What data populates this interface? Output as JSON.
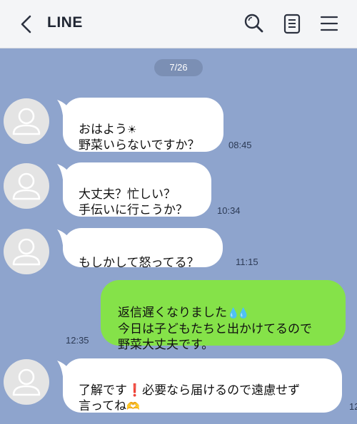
{
  "header": {
    "title": "LINE",
    "icons": [
      "back-icon",
      "search-icon",
      "memo-icon",
      "menu-icon"
    ]
  },
  "date_chip": "7/26",
  "messages": [
    {
      "side": "in",
      "lines": [
        "おはよう",
        "野菜いらないですか？"
      ],
      "emoji": "sun",
      "time": "08:45"
    },
    {
      "side": "in",
      "lines": [
        "大丈夫？忙しい？",
        "手伝いに行こうか？"
      ],
      "time": "10:34"
    },
    {
      "side": "in",
      "lines": [
        "もしかして怒ってる？"
      ],
      "time": "11:15"
    },
    {
      "side": "out",
      "lines": [
        "返信遅くなりました",
        "今日は子どもたちと出かけてるので",
        "野菜大丈夫です。"
      ],
      "emoji": "sweat-drops",
      "time": "12:35"
    },
    {
      "side": "in",
      "lines": [
        "了解です",
        "必要なら届けるので遠慮せず",
        "言ってね"
      ],
      "emoji": "exclamation, heart-hands",
      "time": "12"
    }
  ],
  "colors": {
    "background": "#8ea4cd",
    "header": "#f4f5f7",
    "incoming_bubble": "#ffffff",
    "outgoing_bubble": "#85e249",
    "date_chip": "#7b8fb4"
  }
}
